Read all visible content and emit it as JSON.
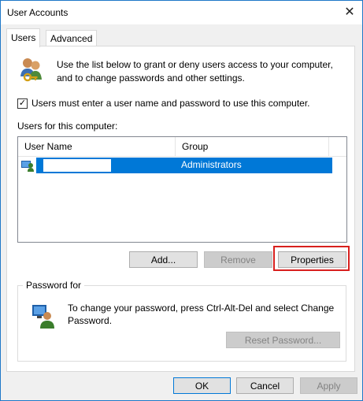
{
  "window": {
    "title": "User Accounts",
    "close_glyph": "✕"
  },
  "tabs": [
    {
      "label": "Users",
      "active": true
    },
    {
      "label": "Advanced",
      "active": false
    }
  ],
  "intro": {
    "text": "Use the list below to grant or deny users access to your computer, and to change passwords and other settings.",
    "icon": "users-keys-icon"
  },
  "require_login": {
    "checked": true,
    "label": "Users must enter a user name and password to use this computer."
  },
  "users": {
    "label": "Users for this computer:",
    "columns": [
      "User Name",
      "Group"
    ],
    "rows": [
      {
        "user_name": "",
        "group": "Administrators",
        "selected": true,
        "icon": "user-icon"
      }
    ]
  },
  "user_buttons": {
    "add": "Add...",
    "remove": "Remove",
    "properties": "Properties"
  },
  "password": {
    "group_title": "Password for",
    "text": "To change your password, press Ctrl-Alt-Del and select Change Password.",
    "reset_button": "Reset Password...",
    "icon": "user-password-icon"
  },
  "dialog_buttons": {
    "ok": "OK",
    "cancel": "Cancel",
    "apply": "Apply"
  },
  "colors": {
    "accent": "#0078d7",
    "highlight": "#d8201e"
  }
}
